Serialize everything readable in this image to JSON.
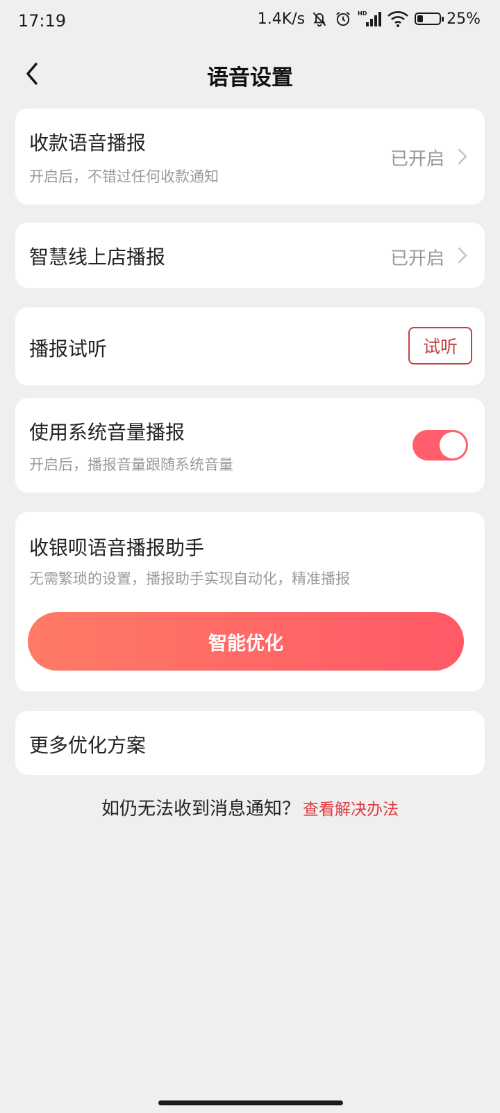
{
  "status_bar": {
    "time": "17:19",
    "net_speed": "1.4K/s",
    "battery_level": 25,
    "battery_text": "25%",
    "icons": [
      "mute-bell-icon",
      "alarm-icon",
      "hd-signal-icon",
      "wifi-icon",
      "battery-icon"
    ]
  },
  "header": {
    "title": "语音设置",
    "back_icon": "chevron-left-icon"
  },
  "items": {
    "payment_voice": {
      "title": "收款语音播报",
      "subtitle": "开启后，不错过任何收款通知",
      "value": "已开启"
    },
    "smart_store": {
      "title": "智慧线上店播报",
      "value": "已开启"
    },
    "listen_test": {
      "title": "播报试听",
      "button": "试听"
    },
    "system_volume": {
      "title": "使用系统音量播报",
      "subtitle": "开启后，播报音量跟随系统音量",
      "toggle_on": true
    },
    "assistant": {
      "title": "收银呗语音播报助手",
      "subtitle": "无需繁琐的设置，播报助手实现自动化，精准播报",
      "button": "智能优化"
    },
    "more": {
      "title": "更多优化方案"
    }
  },
  "help": {
    "question": "如仍无法收到消息通知？",
    "link": "查看解决办法"
  },
  "colors": {
    "accent": "#ff5f6d",
    "link": "#e0393e",
    "background": "#efefef"
  }
}
